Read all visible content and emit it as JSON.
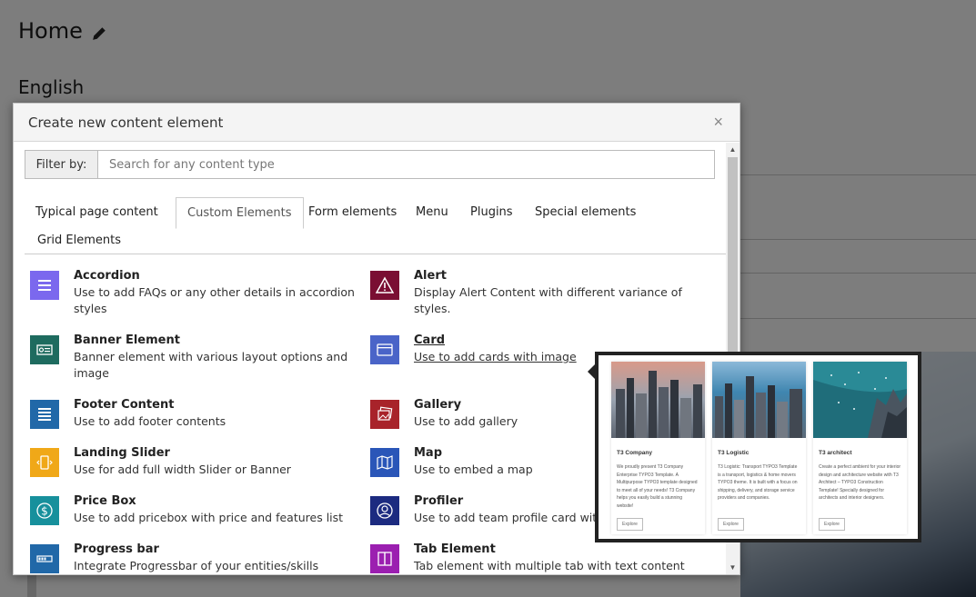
{
  "background": {
    "page_title": "Home",
    "language": "English"
  },
  "modal": {
    "title": "Create new content element",
    "close_icon": "×",
    "filter": {
      "label": "Filter by:",
      "placeholder": "Search for any content type"
    },
    "tabs": [
      {
        "label": "Typical page content"
      },
      {
        "label": "Custom Elements",
        "active": true
      },
      {
        "label": "Form elements"
      },
      {
        "label": "Menu"
      },
      {
        "label": "Plugins"
      },
      {
        "label": "Special elements"
      },
      {
        "label": "Grid Elements"
      }
    ],
    "items": [
      {
        "name": "Accordion",
        "desc": "Use to add FAQs or any other details in accordion styles",
        "icon": "list-icon",
        "color": "#7b68ee"
      },
      {
        "name": "Alert",
        "desc": "Display Alert Content with different variance of styles.",
        "icon": "warning-icon",
        "color": "#7a0e33"
      },
      {
        "name": "Banner Element",
        "desc": "Banner element with various layout options and image",
        "icon": "banner-icon",
        "color": "#1e6b5f"
      },
      {
        "name": "Card",
        "desc": "Use to add cards with image",
        "icon": "card-icon",
        "color": "#4a64c8"
      },
      {
        "name": "Footer Content",
        "desc": "Use to add footer contents",
        "icon": "footer-icon",
        "color": "#2168a8"
      },
      {
        "name": "Gallery",
        "desc": "Use to add gallery",
        "icon": "gallery-icon",
        "color": "#a8232a"
      },
      {
        "name": "Landing Slider",
        "desc": "Use for add full width Slider or Banner",
        "icon": "slider-icon",
        "color": "#f0a818"
      },
      {
        "name": "Map",
        "desc": "Use to embed a map",
        "icon": "map-icon",
        "color": "#2a56b8"
      },
      {
        "name": "Price Box",
        "desc": "Use to add pricebox with price and features list",
        "icon": "dollar-icon",
        "color": "#17909c"
      },
      {
        "name": "Profiler",
        "desc": "Use to add team profile card with",
        "icon": "profile-icon",
        "color": "#1c2b80"
      },
      {
        "name": "Progress bar",
        "desc": "Integrate Progressbar of your entities/skills",
        "icon": "progress-icon",
        "color": "#2168a8"
      },
      {
        "name": "Tab Element",
        "desc": "Tab element with multiple tab with text content",
        "icon": "tab-icon",
        "color": "#9b1fb0"
      }
    ]
  },
  "preview": {
    "cards": [
      {
        "title": "T3 Company",
        "text": "We proudly present T3 Company Enterprise TYPO3 Template. A Multipurpose TYPO3 template designed to meet all of your needs! T3 Company helps you easily build a stunning website!",
        "button": "Explore"
      },
      {
        "title": "T3 Logistic",
        "text": "T3 Logistic: Transport TYPO3 Template is a transport, logistics & home movers TYPO3 theme. It is built with a focus on shipping, delivery, and storage service providers and companies.",
        "button": "Explore"
      },
      {
        "title": "T3 architect",
        "text": "Create a perfect ambient for your interior design and architecture website with T3 Architect – TYPO3 Construction Template! Specially designed for architects and interior designers.",
        "button": "Explore"
      }
    ]
  }
}
